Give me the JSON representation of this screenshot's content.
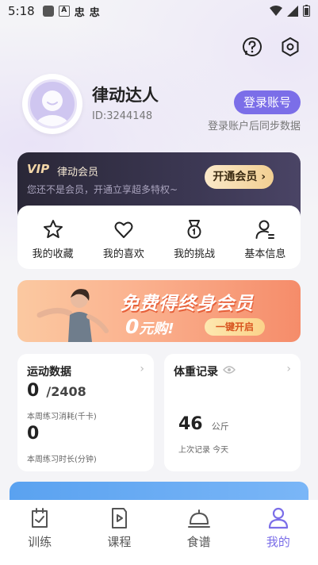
{
  "status_bar": {
    "time": "5:18",
    "notif_icons": [
      "A",
      "忠",
      "忠"
    ]
  },
  "profile": {
    "username": "律动达人",
    "user_id": "ID:3244148",
    "login_button": "登录账号",
    "login_hint": "登录账户后同步数据"
  },
  "vip": {
    "logo": "VIP",
    "title": "律动会员",
    "desc": "您还不是会员，开通立享超多特权~",
    "button": "开通会员 ›"
  },
  "shortcuts": [
    {
      "label": "我的收藏",
      "icon": "star-icon"
    },
    {
      "label": "我的喜欢",
      "icon": "heart-icon"
    },
    {
      "label": "我的挑战",
      "icon": "medal-icon"
    },
    {
      "label": "基本信息",
      "icon": "user-info-icon"
    }
  ],
  "banner": {
    "title": "免费得终身会员",
    "sub_num": "0",
    "sub_text": "元购!",
    "button": "一键开启"
  },
  "sport": {
    "title": "运动数据",
    "calories": "0",
    "calories_total": "/2408",
    "calories_label": "本周练习消耗(千卡)",
    "duration": "0",
    "duration_label": "本周练习时长(分钟)"
  },
  "weight": {
    "title": "体重记录",
    "value": "46",
    "unit": "公斤",
    "last_label": "上次记录 今天"
  },
  "tabs": [
    {
      "label": "训练",
      "icon": "training-icon"
    },
    {
      "label": "课程",
      "icon": "course-icon"
    },
    {
      "label": "食谱",
      "icon": "recipe-icon"
    },
    {
      "label": "我的",
      "icon": "profile-icon"
    }
  ],
  "colors": {
    "accent": "#7b6ee8",
    "vip_gold": "#f2cf92",
    "banner_orange": "#f58c6a"
  }
}
